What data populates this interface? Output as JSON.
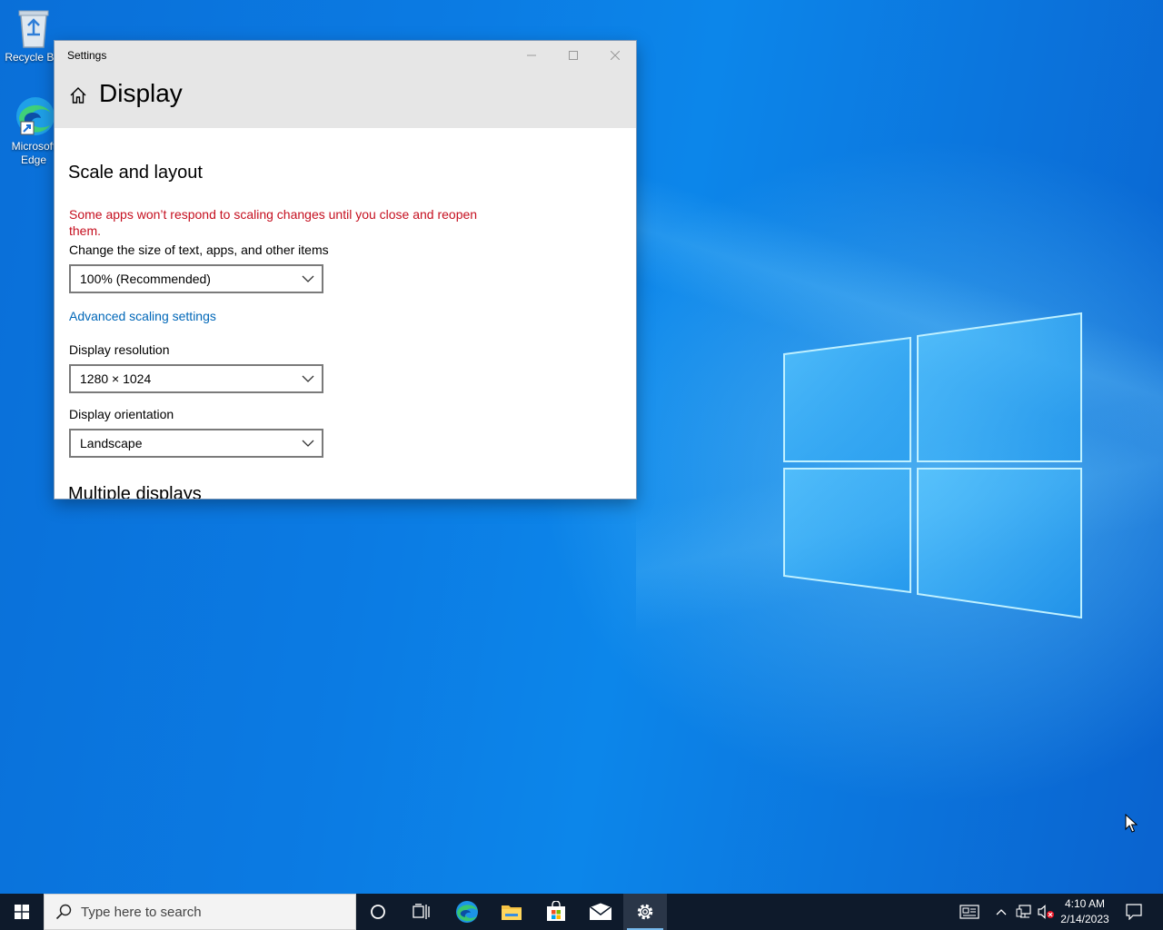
{
  "desktop": {
    "icons": [
      {
        "label": "Recycle Bin"
      },
      {
        "label": "Microsoft Edge"
      }
    ]
  },
  "settings_window": {
    "title": "Settings",
    "page_title": "Display",
    "section_title": "Scale and layout",
    "warning": "Some apps won’t respond to scaling changes until you close and reopen them.",
    "scale_label": "Change the size of text, apps, and other items",
    "scale_value": "100% (Recommended)",
    "advanced_link": "Advanced scaling settings",
    "resolution_label": "Display resolution",
    "resolution_value": "1280 × 1024",
    "orientation_label": "Display orientation",
    "orientation_value": "Landscape",
    "next_section_partial": "Multiple displays"
  },
  "taskbar": {
    "search_placeholder": "Type here to search",
    "pinned": [
      "Cortana",
      "Task View",
      "Microsoft Edge",
      "File Explorer",
      "Microsoft Store",
      "Mail",
      "Settings"
    ],
    "active_app": "Settings",
    "clock": {
      "time": "4:10 AM",
      "date": "2/14/2023"
    }
  },
  "colors": {
    "warning_red": "#c50f1f",
    "link_blue": "#0067b8",
    "taskbar_bg": "#0e1a2b",
    "desktop_blue": "#0b7be3"
  }
}
